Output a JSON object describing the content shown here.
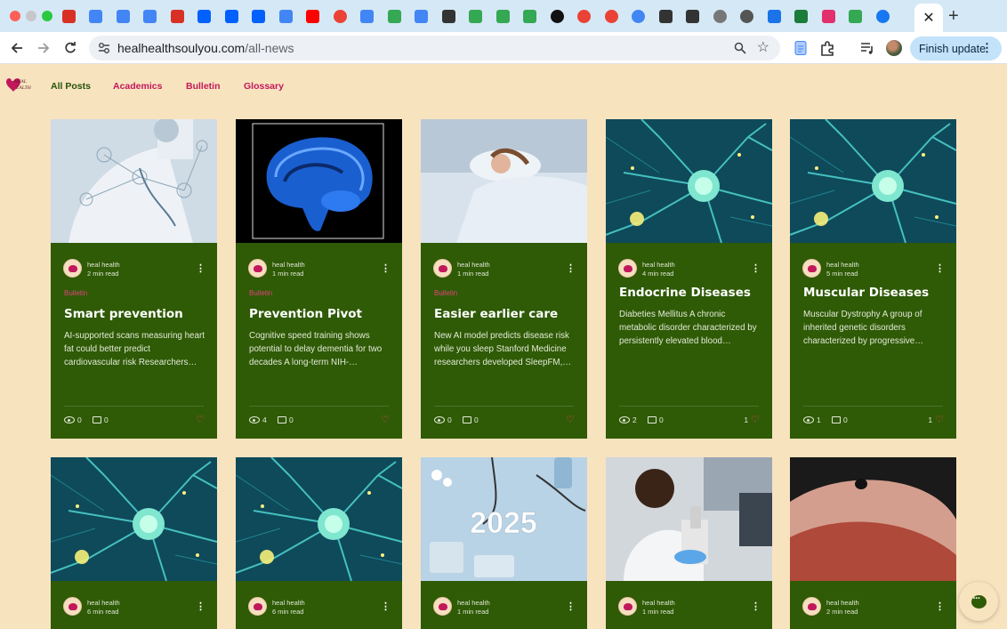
{
  "browser": {
    "url_host": "healhealthsoulyou.com",
    "url_path": "/all-news",
    "finish_update_label": "Finish update",
    "tab_favicons": [
      {
        "icon": "gmail-icon",
        "color": "#d93025"
      },
      {
        "icon": "docs-icon",
        "color": "#4285f4"
      },
      {
        "icon": "check-doc-icon",
        "color": "#4285f4"
      },
      {
        "icon": "check-doc-icon",
        "color": "#4285f4"
      },
      {
        "icon": "gmail-icon",
        "color": "#d93025"
      },
      {
        "icon": "dropbox-icon",
        "color": "#0061fe"
      },
      {
        "icon": "dropbox-icon",
        "color": "#0061fe"
      },
      {
        "icon": "dropbox-icon",
        "color": "#0061fe"
      },
      {
        "icon": "docs-icon",
        "color": "#4285f4"
      },
      {
        "icon": "youtube-icon",
        "color": "#ff0000"
      },
      {
        "icon": "google-icon",
        "color": "#ea4335"
      },
      {
        "icon": "docs-icon",
        "color": "#4285f4"
      },
      {
        "icon": "drive-icon",
        "color": "#34a853"
      },
      {
        "icon": "docs-icon",
        "color": "#4285f4"
      },
      {
        "icon": "wix-icon",
        "color": "#333333"
      },
      {
        "icon": "drive-icon",
        "color": "#34a853"
      },
      {
        "icon": "drive-icon",
        "color": "#34a853"
      },
      {
        "icon": "drive-icon",
        "color": "#34a853"
      },
      {
        "icon": "triangle-icon",
        "color": "#111111"
      },
      {
        "icon": "google-icon",
        "color": "#ea4335"
      },
      {
        "icon": "google-icon",
        "color": "#ea4335"
      },
      {
        "icon": "history-icon",
        "color": "#4285f4"
      },
      {
        "icon": "wix-icon",
        "color": "#333333"
      },
      {
        "icon": "wix-icon",
        "color": "#333333"
      },
      {
        "icon": "globe-icon",
        "color": "#777777"
      },
      {
        "icon": "globe-icon",
        "color": "#555555"
      },
      {
        "icon": "share-icon",
        "color": "#1a73e8"
      },
      {
        "icon": "perplexity-icon",
        "color": "#1c7c3a"
      },
      {
        "icon": "instagram-icon",
        "color": "#e1306c"
      },
      {
        "icon": "drive-icon",
        "color": "#34a853"
      },
      {
        "icon": "facebook-icon",
        "color": "#1877f2"
      }
    ]
  },
  "site": {
    "logo_text": "HEAL HEALTH",
    "nav": [
      {
        "label": "All Posts",
        "active": true
      },
      {
        "label": "Academics",
        "active": false
      },
      {
        "label": "Bulletin",
        "active": false
      },
      {
        "label": "Glossary",
        "active": false
      }
    ]
  },
  "colors": {
    "page_bg": "#f8e3bf",
    "card_bg": "#2f5a06",
    "category": "#e0447c",
    "heart": "#e24a5a"
  },
  "posts": [
    {
      "author": "heal health",
      "read_time": "2 min read",
      "category": "Bulletin",
      "title": "Smart prevention",
      "excerpt": "AI-supported scans measuring heart fat could better predict cardiovascular risk Researchers…",
      "views": "0",
      "comments": "0",
      "likes": "",
      "image": "doctor-tech"
    },
    {
      "author": "heal health",
      "read_time": "1 min read",
      "category": "Bulletin",
      "title": "Prevention Pivot",
      "excerpt": "Cognitive speed training shows potential to delay dementia for two decades A long-term NIH-…",
      "views": "4",
      "comments": "0",
      "likes": "",
      "image": "brain-scan"
    },
    {
      "author": "heal health",
      "read_time": "1 min read",
      "category": "Bulletin",
      "title": "Easier earlier care",
      "excerpt": "New AI model predicts disease risk while you sleep Stanford Medicine researchers developed SleepFM,…",
      "views": "0",
      "comments": "0",
      "likes": "",
      "image": "sleep"
    },
    {
      "author": "heal health",
      "read_time": "4 min read",
      "category": "",
      "title": "Endocrine Diseases",
      "excerpt": "Diabeties Mellitus A chronic metabolic disorder characterized by persistently elevated blood…",
      "views": "2",
      "comments": "0",
      "likes": "1",
      "image": "neuron"
    },
    {
      "author": "heal health",
      "read_time": "5 min read",
      "category": "",
      "title": "Muscular Diseases",
      "excerpt": "Muscular Dystrophy A group of inherited genetic disorders characterized by progressive…",
      "views": "1",
      "comments": "0",
      "likes": "1",
      "image": "neuron"
    },
    {
      "author": "heal health",
      "read_time": "6 min read",
      "image": "neuron"
    },
    {
      "author": "heal health",
      "read_time": "6 min read",
      "image": "neuron"
    },
    {
      "author": "heal health",
      "read_time": "1 min read",
      "image": "year-2025",
      "image_text": "2025"
    },
    {
      "author": "heal health",
      "read_time": "1 min read",
      "image": "lab"
    },
    {
      "author": "heal health",
      "read_time": "2 min read",
      "image": "fingertip"
    }
  ]
}
